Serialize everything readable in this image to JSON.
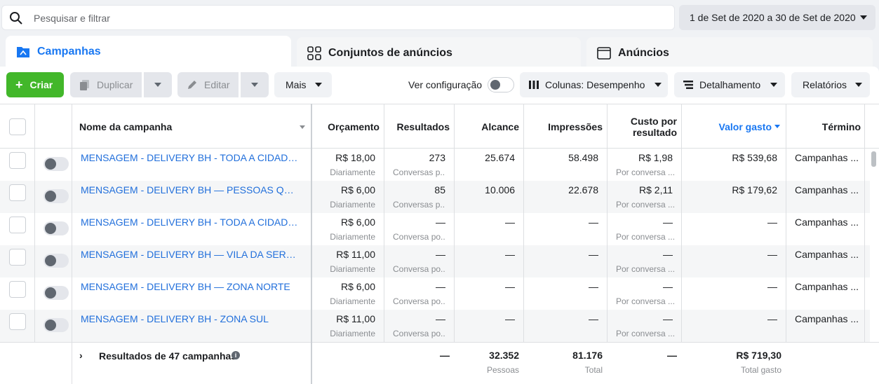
{
  "search": {
    "placeholder": "Pesquisar e filtrar"
  },
  "date_range": "1 de Set de 2020 a 30 de Set de 2020",
  "tabs": [
    {
      "label": "Campanhas"
    },
    {
      "label": "Conjuntos de anúncios"
    },
    {
      "label": "Anúncios"
    }
  ],
  "toolbar": {
    "create": "Criar",
    "duplicate": "Duplicar",
    "edit": "Editar",
    "more": "Mais",
    "view_settings": "Ver configuração",
    "columns": "Colunas: Desempenho",
    "breakdown": "Detalhamento",
    "reports": "Relatórios"
  },
  "columns": {
    "name": "Nome da campanha",
    "budget": "Orçamento",
    "results": "Resultados",
    "reach": "Alcance",
    "impressions": "Impressões",
    "cost_per_result_1": "Custo por",
    "cost_per_result_2": "resultado",
    "amount_spent": "Valor gasto",
    "ends": "Término"
  },
  "rows": [
    {
      "name": "MENSAGEM - DELIVERY BH - TODA A CIDADE - ...",
      "budget": "R$ 18,00",
      "budget_sub": "Diariamente",
      "results": "273",
      "results_sub": "Conversas p...",
      "reach": "25.674",
      "impressions": "58.498",
      "cpr": "R$ 1,98",
      "cpr_sub": "Por conversa ...",
      "spent": "R$ 539,68",
      "ends": "Campanhas ..."
    },
    {
      "name": "MENSAGEM - DELIVERY BH — PESSOAS QUE N...",
      "budget": "R$ 6,00",
      "budget_sub": "Diariamente",
      "results": "85",
      "results_sub": "Conversas p...",
      "reach": "10.006",
      "impressions": "22.678",
      "cpr": "R$ 2,11",
      "cpr_sub": "Por conversa ...",
      "spent": "R$ 179,62",
      "ends": "Campanhas ..."
    },
    {
      "name": "MENSAGEM - DELIVERY BH - TODA A CIDADE - ...",
      "budget": "R$ 6,00",
      "budget_sub": "Diariamente",
      "results": "—",
      "results_sub": "Conversa po...",
      "reach": "—",
      "impressions": "—",
      "cpr": "—",
      "cpr_sub": "Por conversa ...",
      "spent": "—",
      "ends": "Campanhas ..."
    },
    {
      "name": "MENSAGEM - DELIVERY BH — VILA DA SERRA",
      "budget": "R$ 11,00",
      "budget_sub": "Diariamente",
      "results": "—",
      "results_sub": "Conversa po...",
      "reach": "—",
      "impressions": "—",
      "cpr": "—",
      "cpr_sub": "Por conversa ...",
      "spent": "—",
      "ends": "Campanhas ..."
    },
    {
      "name": "MENSAGEM - DELIVERY BH — ZONA NORTE",
      "budget": "R$ 6,00",
      "budget_sub": "Diariamente",
      "results": "—",
      "results_sub": "Conversa po...",
      "reach": "—",
      "impressions": "—",
      "cpr": "—",
      "cpr_sub": "Por conversa ...",
      "spent": "—",
      "ends": "Campanhas ..."
    },
    {
      "name": "MENSAGEM - DELIVERY BH - ZONA SUL",
      "budget": "R$ 11,00",
      "budget_sub": "Diariamente",
      "results": "—",
      "results_sub": "Conversa po...",
      "reach": "—",
      "impressions": "—",
      "cpr": "—",
      "cpr_sub": "Por conversa ...",
      "spent": "—",
      "ends": "Campanhas ..."
    }
  ],
  "footer": {
    "label": "Resultados de 47 campanhas",
    "results": "—",
    "reach": "32.352",
    "reach_sub": "Pessoas",
    "impressions": "81.176",
    "impressions_sub": "Total",
    "cpr": "—",
    "spent": "R$ 719,30",
    "spent_sub": "Total gasto"
  },
  "colors": {
    "accent": "#1877f2",
    "link": "#216fdb",
    "create": "#42b72a"
  }
}
